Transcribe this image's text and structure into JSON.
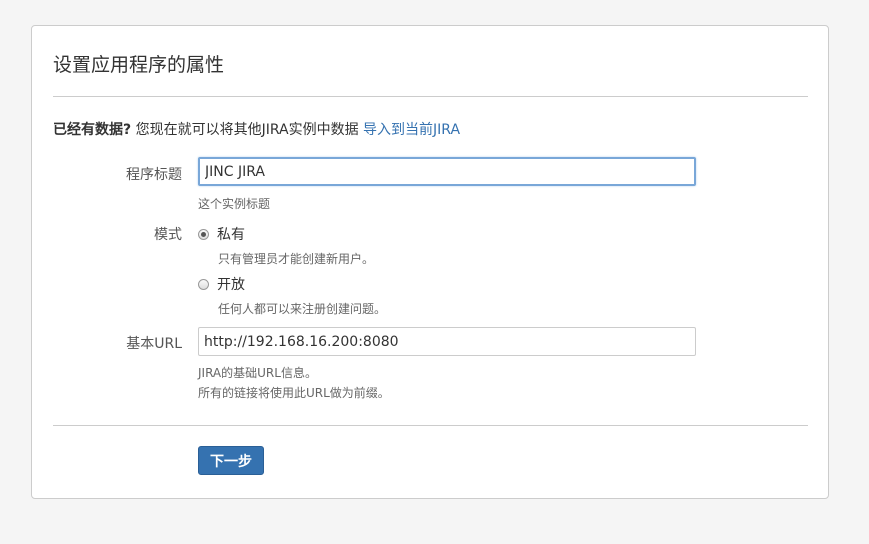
{
  "page": {
    "title": "设置应用程序的属性"
  },
  "intro": {
    "bold": "已经有数据?",
    "text": " 您现在就可以将其他JIRA实例中数据 ",
    "link": "导入到当前JIRA"
  },
  "app_title": {
    "label": "程序标题",
    "value": "JINC JIRA",
    "description": "这个实例标题"
  },
  "mode": {
    "label": "模式",
    "options": [
      {
        "label": "私有",
        "description": "只有管理员才能创建新用户。",
        "selected": true
      },
      {
        "label": "开放",
        "description": "任何人都可以来注册创建问题。",
        "selected": false
      }
    ]
  },
  "base_url": {
    "label": "基本URL",
    "value": "http://192.168.16.200:8080",
    "description_line1": "JIRA的基础URL信息。",
    "description_line2": "所有的链接将使用此URL做为前缀。"
  },
  "actions": {
    "next_label": "下一步"
  },
  "colors": {
    "primary": "#3572b0",
    "link": "#3572b0",
    "focus_border": "#79a7d8"
  }
}
